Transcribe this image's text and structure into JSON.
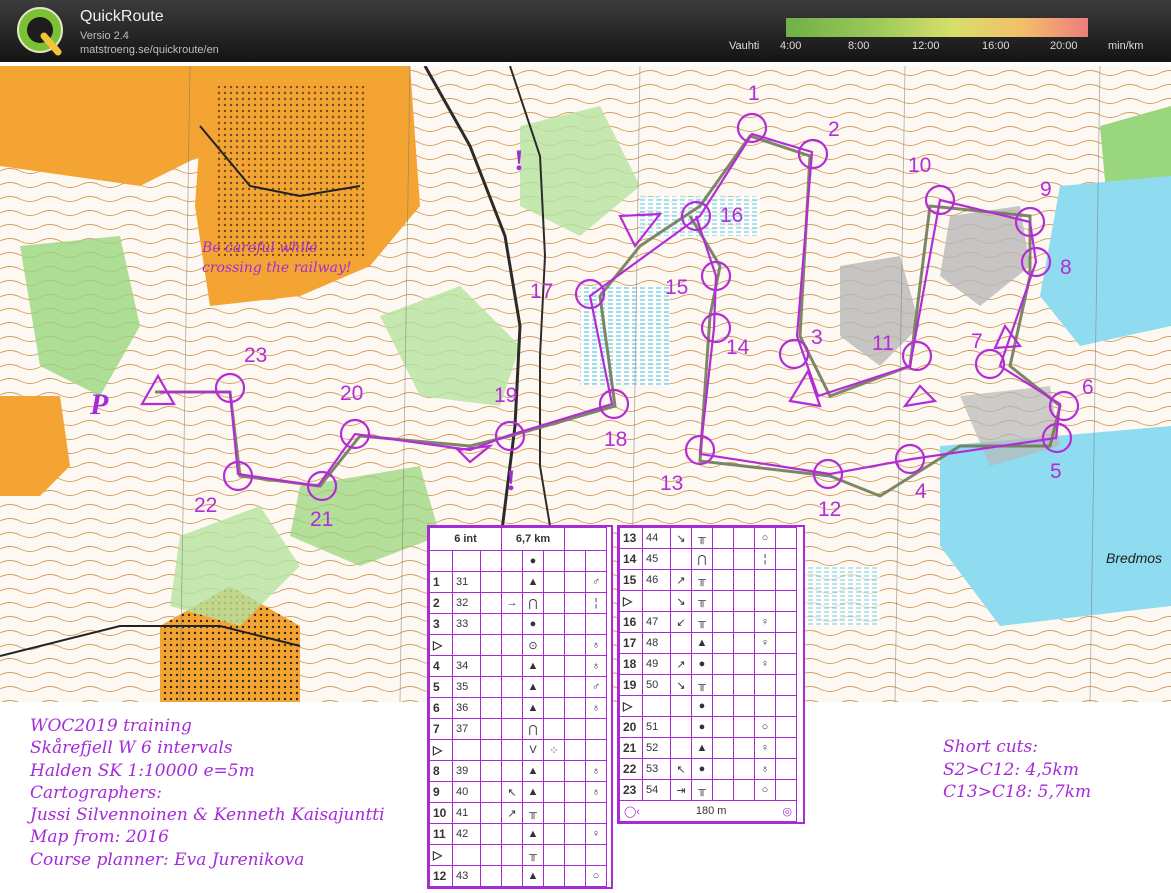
{
  "app": {
    "name": "QuickRoute",
    "version": "Versio 2.4",
    "url": "matstroeng.se/quickroute/en"
  },
  "pace_scale": {
    "label": "Vauhti",
    "ticks": [
      "4:00",
      "8:00",
      "12:00",
      "16:00",
      "20:00"
    ],
    "unit": "min/km",
    "colors": [
      "#6fb046",
      "#d7df6a",
      "#f3bf6a",
      "#ee7d7d"
    ]
  },
  "map": {
    "controls": [
      "1",
      "2",
      "3",
      "4",
      "5",
      "6",
      "7",
      "8",
      "9",
      "10",
      "11",
      "12",
      "13",
      "14",
      "15",
      "16",
      "17",
      "18",
      "19",
      "20",
      "21",
      "22",
      "23"
    ],
    "start_marker": "P",
    "exclamation": "!",
    "note": [
      "Be careful while",
      "crossing the railway!"
    ],
    "place_name": "Bredmos",
    "colors": {
      "course": "#b32cd6",
      "route": "#6f7a58",
      "forest_open": "#f3a433",
      "green": "#7ac36a",
      "water": "#6fd2ea"
    }
  },
  "info": {
    "lines": [
      "WOC2019 training",
      "Skårefjell W 6 intervals",
      "Halden SK 1:10000 e=5m",
      "Cartographers:",
      "Jussi Silvennoinen & Kenneth Kaisajuntti",
      "Map from: 2016",
      "Course planner: Eva Jurenikova"
    ]
  },
  "shortcuts": {
    "lines": [
      "Short cuts:",
      "S2>C12: 4,5km",
      "C13>C18: 5,7km"
    ]
  },
  "description_left": {
    "header": [
      "6 int",
      "6,7 km"
    ],
    "rows": [
      {
        "num": "",
        "code": "",
        "c": "",
        "d": "",
        "e": "●",
        "f": "",
        "g": "",
        "h": ""
      },
      {
        "num": "1",
        "code": "31",
        "c": "",
        "d": "",
        "e": "▲",
        "f": "",
        "g": "",
        "h": "♂"
      },
      {
        "num": "2",
        "code": "32",
        "c": "",
        "d": "→",
        "e": "⋂",
        "f": "",
        "g": "",
        "h": "¦"
      },
      {
        "num": "3",
        "code": "33",
        "c": "",
        "d": "",
        "e": "●",
        "f": "",
        "g": "",
        "h": ""
      },
      {
        "num": "▷",
        "code": "",
        "c": "",
        "d": "",
        "e": "⊙",
        "f": "",
        "g": "",
        "h": "♁"
      },
      {
        "num": "4",
        "code": "34",
        "c": "",
        "d": "",
        "e": "▲",
        "f": "",
        "g": "",
        "h": "♁"
      },
      {
        "num": "5",
        "code": "35",
        "c": "",
        "d": "",
        "e": "▲",
        "f": "",
        "g": "",
        "h": "♂"
      },
      {
        "num": "6",
        "code": "36",
        "c": "",
        "d": "",
        "e": "▲",
        "f": "",
        "g": "",
        "h": "♁"
      },
      {
        "num": "7",
        "code": "37",
        "c": "",
        "d": "",
        "e": "⋂",
        "f": "",
        "g": "",
        "h": ""
      },
      {
        "num": "▷",
        "code": "",
        "c": "",
        "d": "",
        "e": "V",
        "f": "⁘",
        "g": "",
        "h": ""
      },
      {
        "num": "8",
        "code": "39",
        "c": "",
        "d": "",
        "e": "▲",
        "f": "",
        "g": "",
        "h": "♁"
      },
      {
        "num": "9",
        "code": "40",
        "c": "",
        "d": "↖",
        "e": "▲",
        "f": "",
        "g": "",
        "h": "♁"
      },
      {
        "num": "10",
        "code": "41",
        "c": "",
        "d": "↗",
        "e": "╥",
        "f": "",
        "g": "",
        "h": ""
      },
      {
        "num": "11",
        "code": "42",
        "c": "",
        "d": "",
        "e": "▲",
        "f": "",
        "g": "",
        "h": "♀"
      },
      {
        "num": "▷",
        "code": "",
        "c": "",
        "d": "",
        "e": "╥",
        "f": "",
        "g": "",
        "h": ""
      },
      {
        "num": "12",
        "code": "43",
        "c": "",
        "d": "",
        "e": "▲",
        "f": "",
        "g": "",
        "h": "○"
      }
    ]
  },
  "description_right": {
    "rows": [
      {
        "num": "13",
        "code": "44",
        "d": "↘",
        "e": "╥",
        "h": "○"
      },
      {
        "num": "14",
        "code": "45",
        "d": "",
        "e": "⋂",
        "h": "¦"
      },
      {
        "num": "15",
        "code": "46",
        "d": "↗",
        "e": "╥",
        "h": ""
      },
      {
        "num": "▷",
        "code": "",
        "d": "↘",
        "e": "╥",
        "h": ""
      },
      {
        "num": "16",
        "code": "47",
        "d": "↙",
        "e": "╥",
        "h": "♀"
      },
      {
        "num": "17",
        "code": "48",
        "d": "",
        "e": "▲",
        "h": "♀"
      },
      {
        "num": "18",
        "code": "49",
        "d": "↗",
        "e": "●",
        "h": "♀"
      },
      {
        "num": "19",
        "code": "50",
        "d": "↘",
        "e": "╥",
        "h": ""
      },
      {
        "num": "▷",
        "code": "",
        "d": "",
        "e": "●",
        "h": ""
      },
      {
        "num": "20",
        "code": "51",
        "d": "",
        "e": "●",
        "h": "○"
      },
      {
        "num": "21",
        "code": "52",
        "d": "",
        "e": "▲",
        "h": "♀"
      },
      {
        "num": "22",
        "code": "53",
        "d": "↖",
        "e": "●",
        "h": "♁"
      },
      {
        "num": "23",
        "code": "54",
        "d": "⇥",
        "e": "╥",
        "h": "○"
      }
    ],
    "footer": "180 m"
  }
}
